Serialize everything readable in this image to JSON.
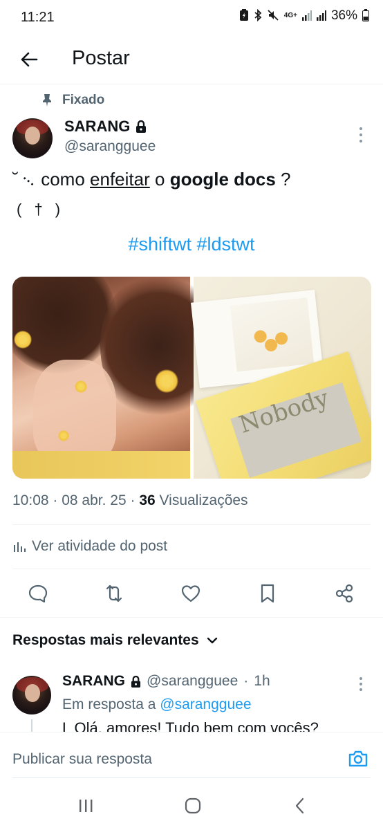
{
  "status_bar": {
    "time": "11:21",
    "battery": "36%",
    "network": "4G+"
  },
  "header": {
    "title": "Postar"
  },
  "post": {
    "pinned_label": "Fixado",
    "author_name": "SARANG",
    "author_handle": "@sarangguee",
    "text": {
      "prefix": "˘ ᨞  como ",
      "underlined": "enfeitar",
      "middle": " o ",
      "bold": "google docs",
      "suffix": " ?"
    },
    "symbol_line": "( † )",
    "hashtags": [
      "#shiftwt",
      "#ldstwt"
    ],
    "images": [
      "woman-with-yellow-flowers",
      "nobody-book-flatlay"
    ],
    "image_text": "Nobody",
    "time": "10:08",
    "date": "08 abr. 25",
    "views_count": "36",
    "views_label": "Visualizações",
    "activity_label": "Ver atividade do post"
  },
  "replies": {
    "sort_label": "Respostas mais relevantes",
    "items": [
      {
        "author_name": "SARANG",
        "author_handle": "@sarangguee",
        "time": "1h",
        "reply_to_prefix": "Em resposta a",
        "reply_to_handle": "@sarangguee",
        "text": "L Olá, amores! Tudo bem com vocês?"
      }
    ]
  },
  "compose": {
    "placeholder": "Publicar sua resposta"
  },
  "colors": {
    "accent": "#1d9bf0",
    "text_primary": "#0f1419",
    "text_secondary": "#536471"
  }
}
